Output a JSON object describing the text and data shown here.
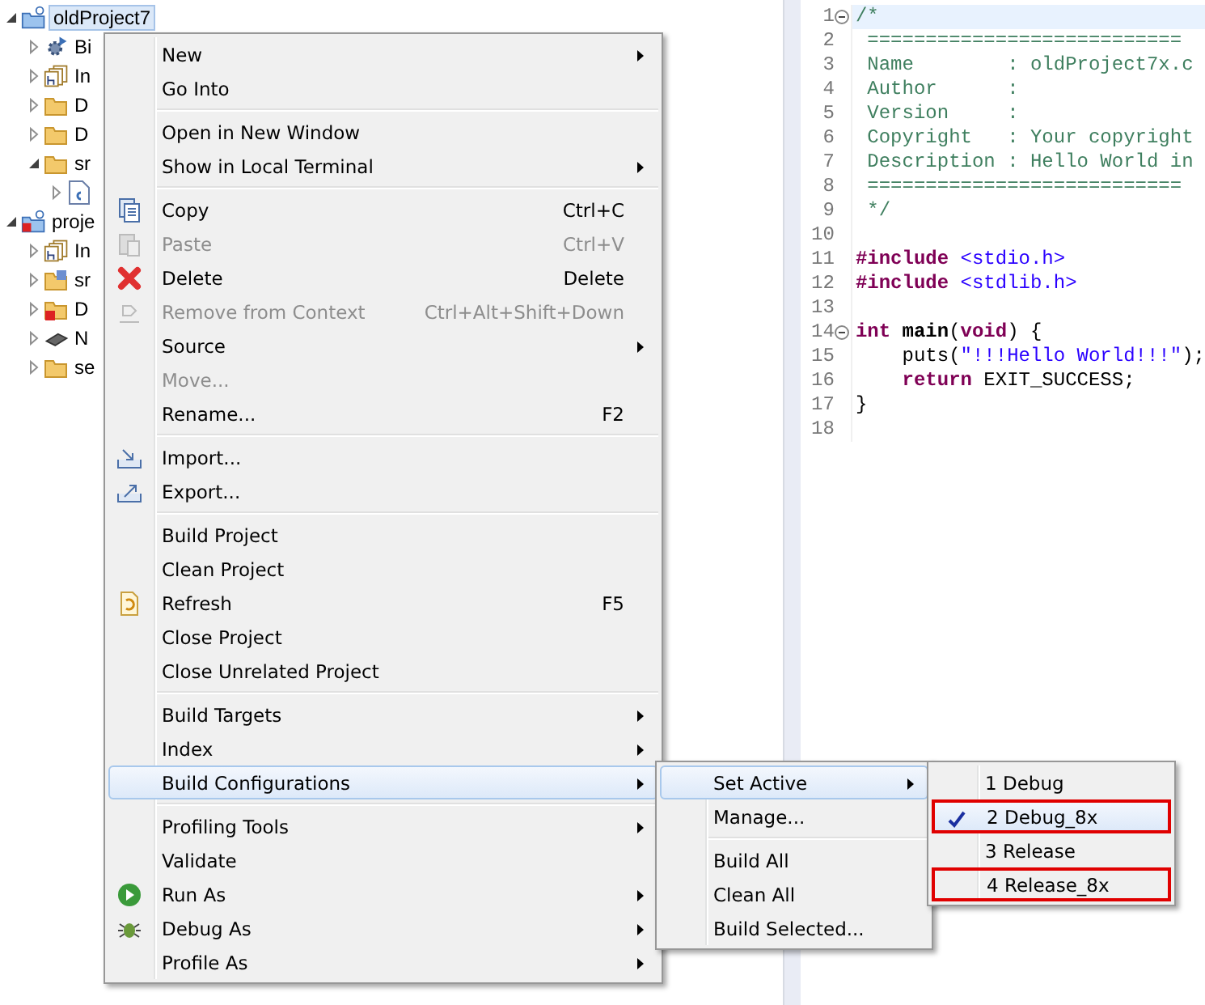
{
  "project_tree": {
    "items": [
      {
        "label": "oldProject7",
        "kind": "project",
        "expanded": true,
        "selected": true,
        "children": [
          {
            "label": "Bi",
            "kind": "binaries",
            "expanded": false
          },
          {
            "label": "In",
            "kind": "includes",
            "expanded": false
          },
          {
            "label": "D",
            "kind": "folder",
            "expanded": false
          },
          {
            "label": "D",
            "kind": "folder",
            "expanded": false
          },
          {
            "label": "sr",
            "kind": "folder",
            "expanded": true,
            "children": [
              {
                "kind": "c-file",
                "expanded": false
              }
            ]
          }
        ]
      },
      {
        "label": "proje",
        "kind": "project-error",
        "expanded": true,
        "selected": false,
        "children": [
          {
            "label": "In",
            "kind": "includes",
            "expanded": false
          },
          {
            "label": "sr",
            "kind": "source-folder",
            "expanded": false
          },
          {
            "label": "D",
            "kind": "error-folder",
            "expanded": false
          },
          {
            "label": "N",
            "kind": "chip",
            "expanded": false
          },
          {
            "label": "se",
            "kind": "folder",
            "expanded": false
          }
        ]
      }
    ]
  },
  "context_menu": {
    "groups": [
      [
        {
          "label": "New",
          "submenu": true,
          "disabled": false,
          "selected": false
        },
        {
          "label": "Go Into",
          "submenu": false,
          "disabled": false,
          "selected": false
        }
      ],
      [
        {
          "label": "Open in New Window",
          "submenu": false,
          "disabled": false,
          "selected": false
        },
        {
          "label": "Show in Local Terminal",
          "submenu": true,
          "disabled": false,
          "selected": false
        }
      ],
      [
        {
          "label": "Copy",
          "kind": "copy",
          "shortcut": "Ctrl+C",
          "submenu": false,
          "disabled": false,
          "selected": false
        },
        {
          "label": "Paste",
          "kind": "paste",
          "shortcut": "Ctrl+V",
          "submenu": false,
          "disabled": true,
          "selected": false
        },
        {
          "label": "Delete",
          "kind": "delete",
          "shortcut": "Delete",
          "submenu": false,
          "disabled": false,
          "selected": false
        },
        {
          "label": "Remove from Context",
          "kind": "remove",
          "shortcut": "Ctrl+Alt+Shift+Down",
          "submenu": false,
          "disabled": true,
          "selected": false
        },
        {
          "label": "Source",
          "submenu": true,
          "disabled": false,
          "selected": false
        },
        {
          "label": "Move...",
          "submenu": false,
          "disabled": true,
          "selected": false
        },
        {
          "label": "Rename...",
          "shortcut": "F2",
          "submenu": false,
          "disabled": false,
          "selected": false
        }
      ],
      [
        {
          "label": "Import...",
          "kind": "import",
          "submenu": false,
          "disabled": false,
          "selected": false
        },
        {
          "label": "Export...",
          "kind": "export",
          "submenu": false,
          "disabled": false,
          "selected": false
        }
      ],
      [
        {
          "label": "Build Project",
          "submenu": false,
          "disabled": false,
          "selected": false
        },
        {
          "label": "Clean Project",
          "submenu": false,
          "disabled": false,
          "selected": false
        },
        {
          "label": "Refresh",
          "kind": "refresh",
          "shortcut": "F5",
          "submenu": false,
          "disabled": false,
          "selected": false
        },
        {
          "label": "Close Project",
          "submenu": false,
          "disabled": false,
          "selected": false
        },
        {
          "label": "Close Unrelated Project",
          "submenu": false,
          "disabled": false,
          "selected": false
        }
      ],
      [
        {
          "label": "Build Targets",
          "submenu": true,
          "disabled": false,
          "selected": false
        },
        {
          "label": "Index",
          "submenu": true,
          "disabled": false,
          "selected": false
        },
        {
          "label": "Build Configurations",
          "submenu": true,
          "disabled": false,
          "selected": true,
          "submenu_groups": [
            [
              {
                "label": "Set Active",
                "submenu": true,
                "selected": true,
                "submenu_items": [
                  {
                    "label": "1 Debug",
                    "checked": false,
                    "selected": false,
                    "annotated": false
                  },
                  {
                    "label": "2 Debug_8x",
                    "checked": true,
                    "selected": true,
                    "annotated": true
                  },
                  {
                    "label": "3 Release",
                    "checked": false,
                    "selected": false,
                    "annotated": false
                  },
                  {
                    "label": "4 Release_8x",
                    "checked": false,
                    "selected": false,
                    "annotated": true
                  }
                ]
              },
              {
                "label": "Manage...",
                "submenu": false,
                "selected": false
              }
            ],
            [
              {
                "label": "Build All",
                "submenu": false,
                "selected": false
              },
              {
                "label": "Clean All",
                "submenu": false,
                "selected": false
              },
              {
                "label": "Build Selected...",
                "submenu": false,
                "selected": false
              }
            ]
          ]
        }
      ],
      [
        {
          "label": "Profiling Tools",
          "submenu": true,
          "disabled": false,
          "selected": false
        },
        {
          "label": "Validate",
          "submenu": false,
          "disabled": false,
          "selected": false
        },
        {
          "label": "Run As",
          "kind": "run",
          "submenu": true,
          "disabled": false,
          "selected": false
        },
        {
          "label": "Debug As",
          "kind": "debug",
          "submenu": true,
          "disabled": false,
          "selected": false
        },
        {
          "label": "Profile As",
          "submenu": true,
          "disabled": false,
          "selected": false
        }
      ]
    ]
  },
  "editor": {
    "lines": [
      {
        "number": "1",
        "fold": true,
        "current": true,
        "tokens": [
          {
            "kind": "comment",
            "text": "/*"
          }
        ]
      },
      {
        "number": "2",
        "fold": false,
        "current": false,
        "tokens": [
          {
            "kind": "comment",
            "text": " ==========================="
          }
        ]
      },
      {
        "number": "3",
        "fold": false,
        "current": false,
        "tokens": [
          {
            "kind": "comment",
            "text": " Name        : oldProject7x.c"
          }
        ]
      },
      {
        "number": "4",
        "fold": false,
        "current": false,
        "tokens": [
          {
            "kind": "comment",
            "text": " Author      :"
          }
        ]
      },
      {
        "number": "5",
        "fold": false,
        "current": false,
        "tokens": [
          {
            "kind": "comment",
            "text": " Version     :"
          }
        ]
      },
      {
        "number": "6",
        "fold": false,
        "current": false,
        "tokens": [
          {
            "kind": "comment",
            "text": " Copyright   : Your copyright"
          }
        ]
      },
      {
        "number": "7",
        "fold": false,
        "current": false,
        "tokens": [
          {
            "kind": "comment",
            "text": " Description : Hello World in"
          }
        ]
      },
      {
        "number": "8",
        "fold": false,
        "current": false,
        "tokens": [
          {
            "kind": "comment",
            "text": " ==========================="
          }
        ]
      },
      {
        "number": "9",
        "fold": false,
        "current": false,
        "tokens": [
          {
            "kind": "comment",
            "text": " */"
          }
        ]
      },
      {
        "number": "10",
        "fold": false,
        "current": false
      },
      {
        "number": "11",
        "fold": false,
        "current": false,
        "tokens": [
          {
            "kind": "keyword",
            "text": "#include"
          },
          {
            "kind": "header",
            "text": " <stdio.h>"
          }
        ]
      },
      {
        "number": "12",
        "fold": false,
        "current": false,
        "tokens": [
          {
            "kind": "keyword",
            "text": "#include"
          },
          {
            "kind": "header",
            "text": " <stdlib.h>"
          }
        ]
      },
      {
        "number": "13",
        "fold": false,
        "current": false
      },
      {
        "number": "14",
        "fold": true,
        "current": false,
        "tokens": [
          {
            "kind": "keyword",
            "text": "int"
          },
          {
            "kind": "function",
            "text": " main"
          },
          {
            "kind": "plain",
            "text": "("
          },
          {
            "kind": "keyword",
            "text": "void"
          },
          {
            "kind": "plain",
            "text": ") {"
          }
        ]
      },
      {
        "number": "15",
        "fold": false,
        "current": false,
        "tokens": [
          {
            "kind": "plain",
            "text": "    puts("
          },
          {
            "kind": "string",
            "text": "\"!!!Hello World!!!\""
          },
          {
            "kind": "plain",
            "text": ");"
          }
        ]
      },
      {
        "number": "16",
        "fold": false,
        "current": false,
        "tokens": [
          {
            "kind": "keyword",
            "text": "    return"
          },
          {
            "kind": "plain",
            "text": " EXIT_SUCCESS;"
          }
        ]
      },
      {
        "number": "17",
        "fold": false,
        "current": false,
        "tokens": [
          {
            "kind": "plain",
            "text": "}"
          }
        ]
      },
      {
        "number": "18",
        "fold": false,
        "current": false
      }
    ]
  }
}
